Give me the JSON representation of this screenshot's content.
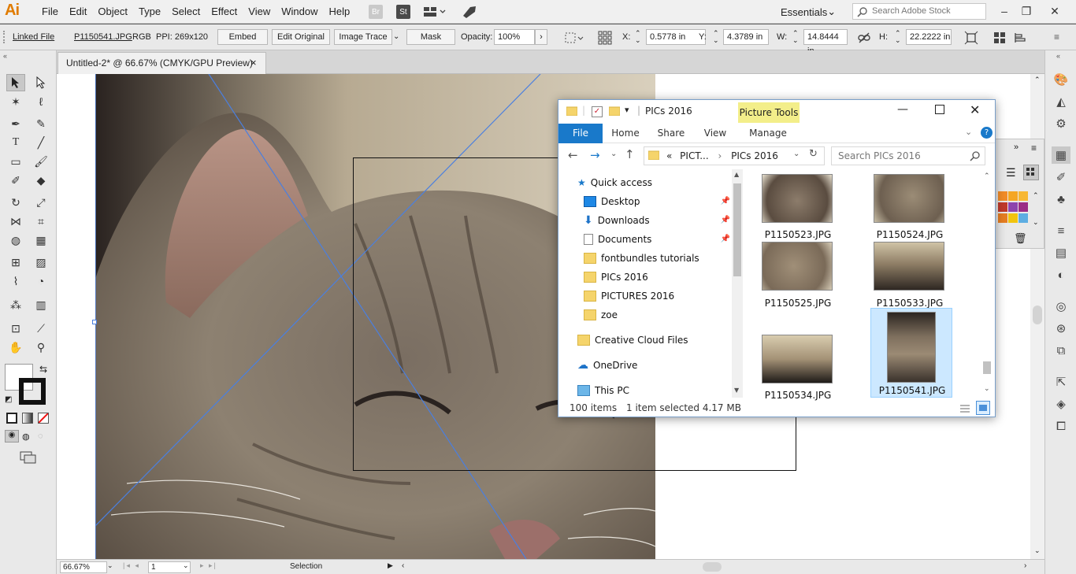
{
  "app": {
    "logo": "Ai",
    "menus": [
      "File",
      "Edit",
      "Object",
      "Type",
      "Select",
      "Effect",
      "View",
      "Window",
      "Help"
    ],
    "bridge_label": "Br",
    "stock_label": "St",
    "workspace": "Essentials",
    "search_placeholder": "Search Adobe Stock"
  },
  "control_bar": {
    "linked_file": "Linked File",
    "filename": "P1150541.JPG",
    "color_mode": "RGB",
    "ppi": "PPI: 269x120",
    "embed": "Embed",
    "edit_original": "Edit Original",
    "image_trace": "Image Trace",
    "mask": "Mask",
    "opacity_label": "Opacity:",
    "opacity_value": "100%",
    "x_label": "X:",
    "x_value": "0.5778 in",
    "y_label": "Y:",
    "y_value": "4.3789 in",
    "w_label": "W:",
    "w_value": "14.8444 in",
    "h_label": "H:",
    "h_value": "22.2222 in"
  },
  "document": {
    "tab_title": "Untitled-2* @ 66.67% (CMYK/GPU Preview)",
    "tab_close": "×"
  },
  "status": {
    "zoom": "66.67%",
    "page": "1",
    "tool": "Selection"
  },
  "explorer": {
    "title": "PICs 2016",
    "picture_tools": "Picture Tools",
    "tabs": [
      "File",
      "Home",
      "Share",
      "View",
      "Manage"
    ],
    "path": [
      "PICT...",
      "PICs 2016"
    ],
    "path_prefix": "«",
    "search_placeholder": "Search PICs 2016",
    "nav": [
      {
        "label": "Quick access",
        "icon": "star-icon"
      },
      {
        "label": "Desktop",
        "icon": "desktop-icon",
        "pinned": true
      },
      {
        "label": "Downloads",
        "icon": "download-icon",
        "pinned": true
      },
      {
        "label": "Documents",
        "icon": "document-icon",
        "pinned": true
      },
      {
        "label": "fontbundles tutorials",
        "icon": "folder-icon"
      },
      {
        "label": "PICs 2016",
        "icon": "folder-icon"
      },
      {
        "label": "PICTURES 2016",
        "icon": "folder-icon"
      },
      {
        "label": "zoe",
        "icon": "folder-icon"
      },
      {
        "label": "Creative Cloud Files",
        "icon": "creative-cloud-icon"
      },
      {
        "label": "OneDrive",
        "icon": "cloud-icon"
      },
      {
        "label": "This PC",
        "icon": "computer-icon"
      }
    ],
    "files": [
      {
        "name": "P1150523.JPG",
        "selected": false
      },
      {
        "name": "P1150524.JPG",
        "selected": false
      },
      {
        "name": "P1150525.JPG",
        "selected": false
      },
      {
        "name": "P1150533.JPG",
        "selected": false
      },
      {
        "name": "P1150534.JPG",
        "selected": false
      },
      {
        "name": "P1150541.JPG",
        "selected": true
      }
    ],
    "item_count": "100 items",
    "selection_info": "1 item selected  4.17 MB"
  },
  "colors": {
    "accent_blue": "#1979ca",
    "selection_bg": "#cce8ff",
    "picture_tools_bg": "#f3ee8a",
    "guide_line": "#4a7fe0"
  }
}
